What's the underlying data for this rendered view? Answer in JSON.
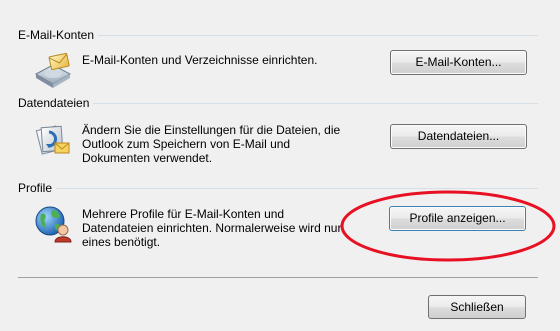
{
  "sections": [
    {
      "title": "E-Mail-Konten",
      "description": "E-Mail-Konten und Verzeichnisse einrichten.",
      "button": "E-Mail-Konten...",
      "icon": "email-accounts-icon"
    },
    {
      "title": "Datendateien",
      "description_lines": [
        "Ändern Sie die Einstellungen für die Dateien, die",
        "Outlook zum Speichern von E-Mail und",
        "Dokumenten verwendet."
      ],
      "button": "Datendateien...",
      "icon": "data-files-icon"
    },
    {
      "title": "Profile",
      "description_lines": [
        "Mehrere Profile für E-Mail-Konten und",
        "Datendateien einrichten. Normalerweise wird nur",
        "eines benötigt."
      ],
      "button": "Profile anzeigen...",
      "icon": "profiles-globe-icon"
    }
  ],
  "close_button": "Schließen",
  "annotation": {
    "shape": "ellipse",
    "color": "#e81123",
    "target": "Profile anzeigen..."
  }
}
